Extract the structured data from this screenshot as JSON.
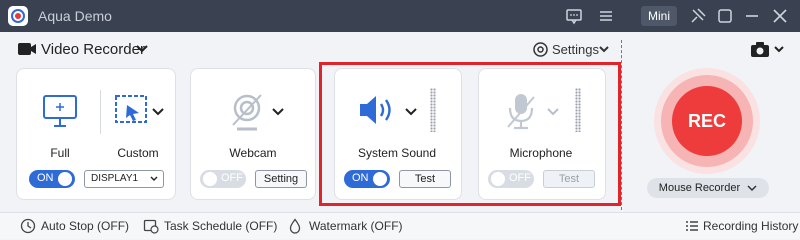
{
  "window": {
    "title": "Aqua Demo",
    "mini_label": "Mini"
  },
  "mode": {
    "label": "Video Recorder"
  },
  "settings": {
    "label": "Settings"
  },
  "cards": {
    "full": {
      "label": "Full"
    },
    "custom": {
      "label": "Custom",
      "display_value": "DISPLAY1"
    },
    "main_toggle": {
      "state": "ON"
    },
    "webcam": {
      "label": "Webcam",
      "toggle": "OFF",
      "button": "Setting"
    },
    "system_sound": {
      "label": "System Sound",
      "toggle": "ON",
      "button": "Test"
    },
    "microphone": {
      "label": "Microphone",
      "toggle": "OFF",
      "button": "Test"
    }
  },
  "rec": {
    "label": "REC",
    "mouse_recorder": "Mouse Recorder"
  },
  "bottom": {
    "auto_stop": "Auto Stop (OFF)",
    "task_schedule": "Task Schedule (OFF)",
    "watermark": "Watermark (OFF)",
    "history": "Recording History"
  },
  "colors": {
    "accent": "#2f6bd6",
    "rec_red": "#ee3b3b",
    "highlight": "#e0242b",
    "titlebar": "#3a4252"
  },
  "icons": [
    "app-logo-icon",
    "message-icon",
    "menu-icon",
    "pin-icon",
    "restore-icon",
    "minimize-icon",
    "close-icon",
    "video-camera-icon",
    "gear-icon",
    "camera-icon",
    "monitor-icon",
    "cursor-region-icon",
    "webcam-icon",
    "speaker-icon",
    "microphone-icon",
    "clock-icon",
    "calendar-clock-icon",
    "droplet-icon",
    "list-icon"
  ]
}
